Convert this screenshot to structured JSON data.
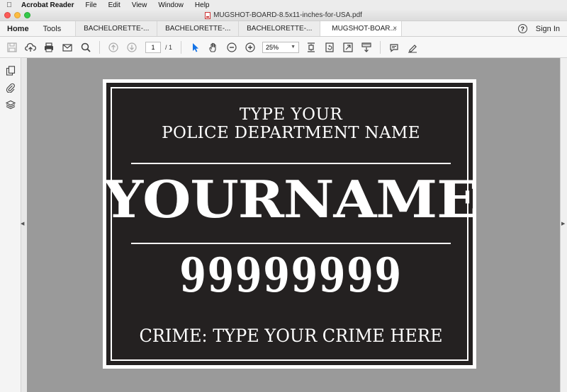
{
  "menubar": {
    "app_name": "Acrobat Reader",
    "items": [
      "File",
      "Edit",
      "View",
      "Window",
      "Help"
    ]
  },
  "window": {
    "title": "MUGSHOT-BOARD-8.5x11-inches-for-USA.pdf"
  },
  "tabs": {
    "home_label": "Home",
    "tools_label": "Tools",
    "documents": [
      {
        "label": "BACHELORETTE-...",
        "active": false
      },
      {
        "label": "BACHELORETTE-...",
        "active": false
      },
      {
        "label": "BACHELORETTE-...",
        "active": false
      },
      {
        "label": "MUGSHOT-BOAR...",
        "active": true
      }
    ],
    "close_glyph": "×",
    "help_glyph": "?",
    "sign_in_label": "Sign In"
  },
  "toolbar": {
    "current_page": "1",
    "page_total": "/ 1",
    "zoom_value": "25%"
  },
  "document": {
    "dept_line1": "TYPE YOUR",
    "dept_line2": "POLICE DEPARTMENT NAME",
    "name": "YOURNAME",
    "number": "99999999",
    "crime": "CRIME: TYPE YOUR CRIME HERE"
  },
  "colors": {
    "board": "#242121",
    "viewport": "#9a9a9a",
    "select_tool": "#1473e6"
  }
}
